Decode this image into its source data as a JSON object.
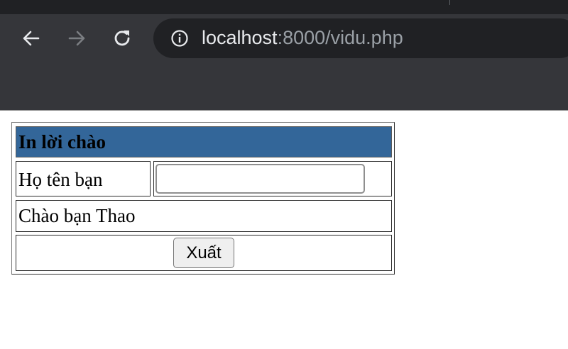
{
  "browser": {
    "url_host": "localhost",
    "url_rest": ":8000/vidu.php",
    "icons": {
      "back": "arrow-left-icon",
      "forward": "arrow-right-icon",
      "reload": "reload-icon",
      "info": "info-icon"
    },
    "forward_enabled": false
  },
  "form": {
    "title": "In lời chào",
    "name_label": "Họ tên bạn",
    "name_value": "",
    "greeting": "Chào bạn Thao",
    "submit_label": "Xuất",
    "title_bg": "#336699"
  }
}
